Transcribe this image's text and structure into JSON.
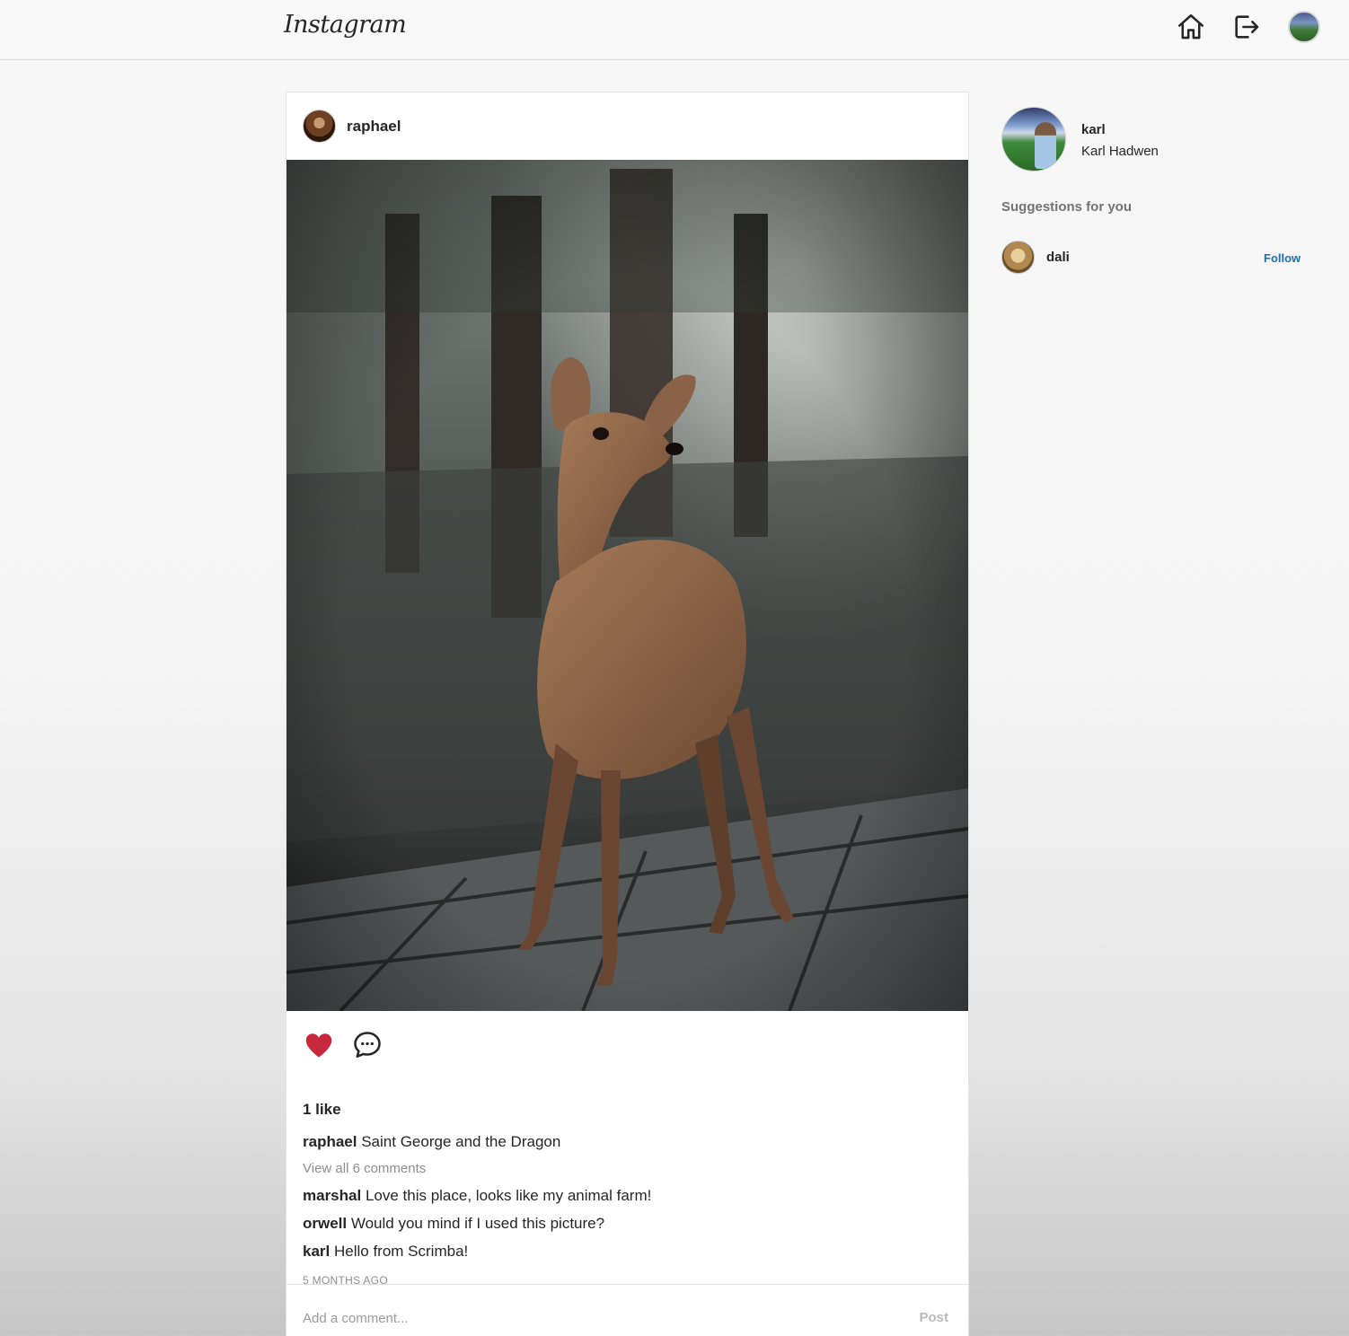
{
  "header": {
    "logo": "Instagram",
    "icons": [
      "home-icon",
      "sign-out-icon",
      "avatar"
    ]
  },
  "post": {
    "username": "raphael",
    "image_alt": "deer",
    "likes_text": "1 like",
    "caption": {
      "username": "raphael",
      "text": "Saint George and the Dragon"
    },
    "view_all_comments": "View all 6 comments",
    "comments": [
      {
        "username": "marshal",
        "text": "Love this place, looks like my animal farm!"
      },
      {
        "username": "orwell",
        "text": "Would you mind if I used this picture?"
      },
      {
        "username": "karl",
        "text": "Hello from Scrimba!"
      }
    ],
    "time_ago": "5 MONTHS AGO",
    "add_comment_placeholder": "Add a comment...",
    "post_button": "Post"
  },
  "sidebar": {
    "username": "karl",
    "full_name": "Karl Hadwen",
    "suggestions_title": "Suggestions for you",
    "suggestions": [
      {
        "username": "dali",
        "action": "Follow"
      }
    ]
  },
  "colors": {
    "like_heart": "#c8283b",
    "follow_link": "#1f6fb2",
    "muted_text": "#8e8e8e"
  }
}
